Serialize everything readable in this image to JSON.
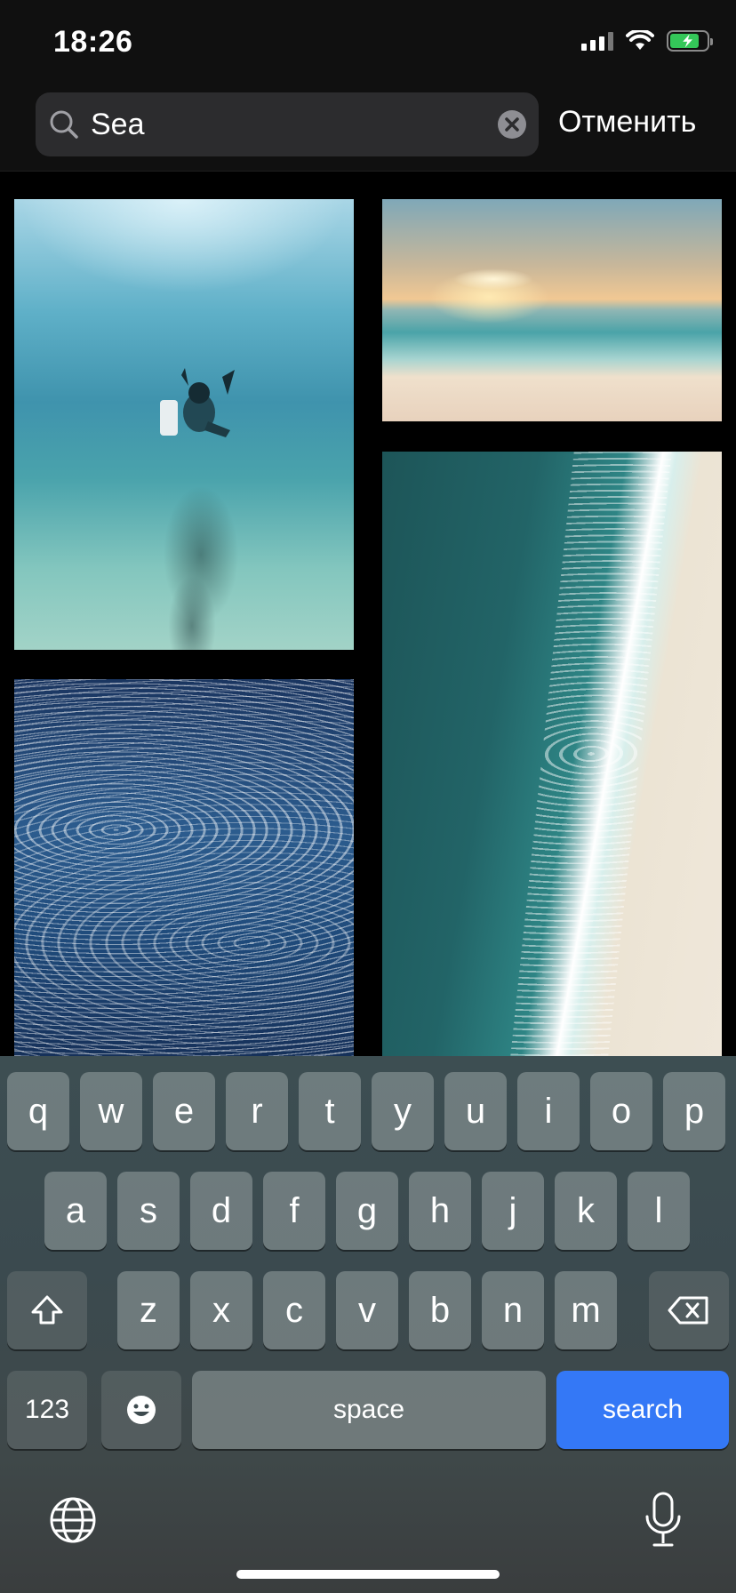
{
  "status_bar": {
    "time": "18:26"
  },
  "search": {
    "query": "Sea",
    "cancel_label": "Отменить"
  },
  "photos": [
    {
      "subject": "Underwater diver"
    },
    {
      "subject": "Beach at sunset"
    },
    {
      "subject": "Ocean waves"
    },
    {
      "subject": "Aerial view of shoreline"
    }
  ],
  "keyboard": {
    "row1": [
      "q",
      "w",
      "e",
      "r",
      "t",
      "y",
      "u",
      "i",
      "o",
      "p"
    ],
    "row2": [
      "a",
      "s",
      "d",
      "f",
      "g",
      "h",
      "j",
      "k",
      "l"
    ],
    "row3": [
      "z",
      "x",
      "c",
      "v",
      "b",
      "n",
      "m"
    ],
    "numbers_label": "123",
    "space_label": "space",
    "search_label": "search"
  },
  "colors": {
    "search_key": "#3478f6",
    "battery": "#34c759"
  }
}
